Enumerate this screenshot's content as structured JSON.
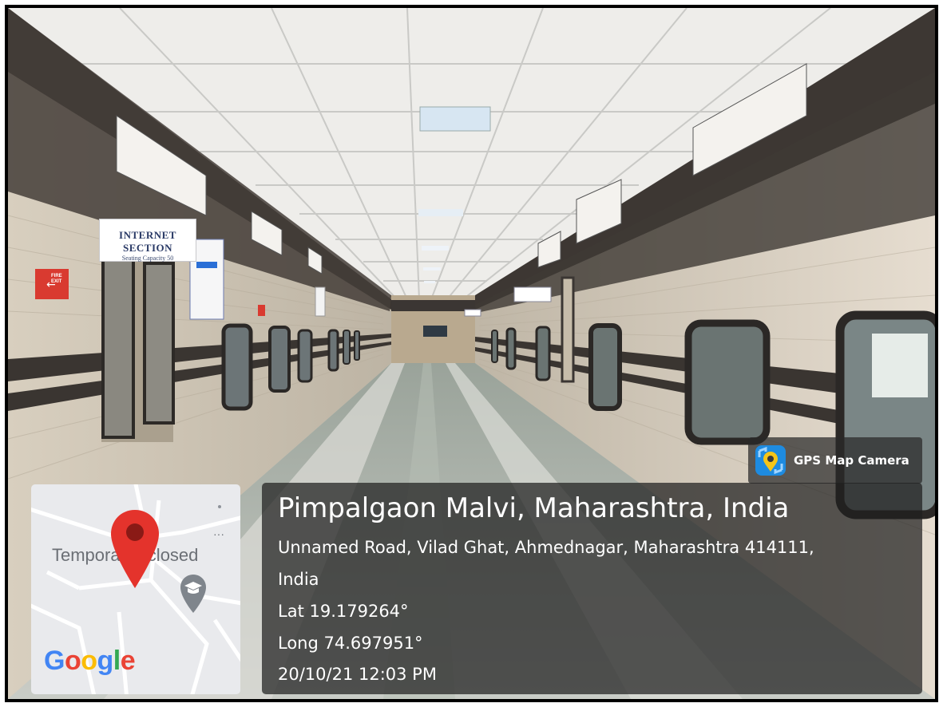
{
  "signs": {
    "internet_section": {
      "title": "INTERNET SECTION",
      "subtitle": "Seating Capacity 50"
    },
    "fire_exit": "FIRE EXIT"
  },
  "gps_badge": {
    "label": "GPS Map Camera",
    "icon": "gps-map-camera-icon"
  },
  "map": {
    "place_label": "Temporarily closed",
    "logo": "Google",
    "icons": [
      "map-pin-icon",
      "education-place-icon"
    ],
    "logo_colors": [
      "#4285F4",
      "#EA4335",
      "#FBBC05",
      "#4285F4",
      "#34A853",
      "#EA4335"
    ]
  },
  "location": {
    "title": "Pimpalgaon Malvi, Maharashtra, India",
    "address_line1": "Unnamed Road, Vilad Ghat, Ahmednagar, Maharashtra 414111,",
    "address_line2": "India",
    "lat": "Lat 19.179264°",
    "long": "Long 74.697951°",
    "datetime": "20/10/21 12:03 PM"
  }
}
